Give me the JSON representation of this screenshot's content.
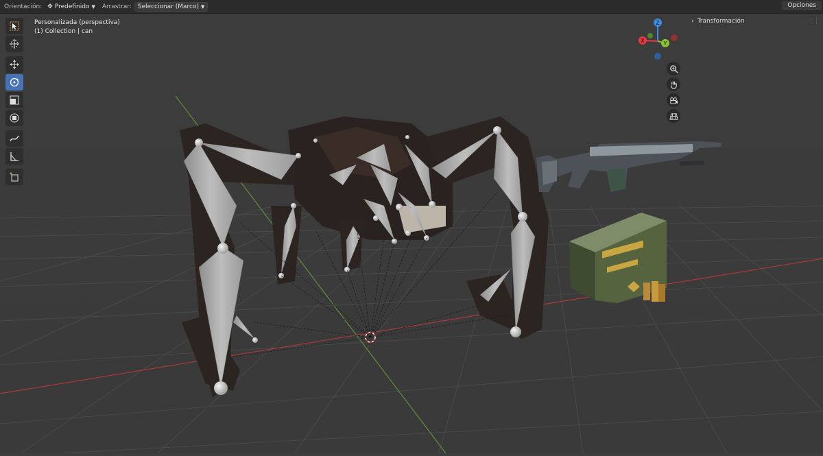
{
  "header": {
    "orientation_label": "Orientación:",
    "orientation_value": "Predefinido",
    "drag_label": "Arrastrar:",
    "drag_value": "Seleccionar (Marco)",
    "options_label": "Opciones"
  },
  "viewport": {
    "view_name": "Personalizada (perspectiva)",
    "collection_info": "(1) Collection | can"
  },
  "sidebar": {
    "transform_label": "Transformación"
  },
  "gizmo": {
    "axes": [
      "Z",
      "X",
      "Y"
    ],
    "colors": {
      "x": "#e5393f",
      "y": "#8bc234",
      "z": "#3b8ee6"
    }
  },
  "toolbar": {
    "tools": [
      "select-box-icon",
      "cursor-icon",
      "move-icon",
      "rotate-icon",
      "scale-icon",
      "transform-icon",
      "annotate-icon",
      "measure-icon",
      "add-cube-icon"
    ],
    "active_tool": "rotate-icon"
  },
  "navigation": {
    "buttons": [
      "zoom-icon",
      "pan-hand-icon",
      "camera-icon",
      "grid-view-icon"
    ]
  },
  "scene": {
    "objects": [
      "spider-rig",
      "rifle",
      "ammo-box"
    ]
  }
}
